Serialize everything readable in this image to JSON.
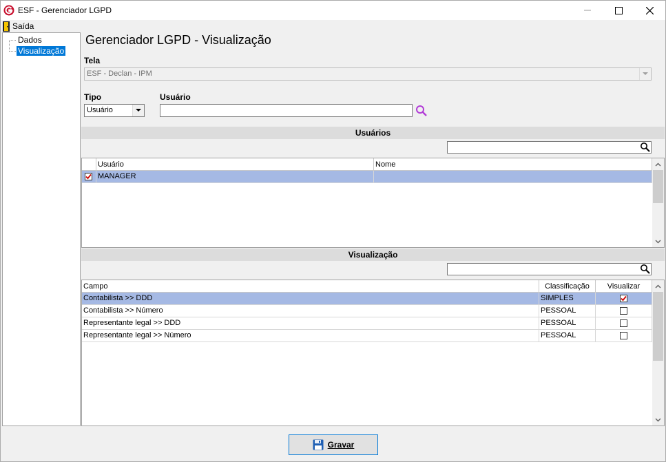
{
  "window": {
    "title": "ESF - Gerenciador LGPD",
    "logo_icon": "app-logo-icon"
  },
  "menu": {
    "exit_label": "Saída"
  },
  "sidebar": {
    "items": [
      {
        "label": "Dados",
        "selected": false
      },
      {
        "label": "Visualização",
        "selected": true
      }
    ]
  },
  "main": {
    "title": "Gerenciador LGPD - Visualização",
    "tela_label": "Tela",
    "tela_value": "ESF - Declan - IPM",
    "tipo_label": "Tipo",
    "tipo_value": "Usuário",
    "usuario_label": "Usuário",
    "usuario_value": ""
  },
  "users_section": {
    "title": "Usuários",
    "search_value": "",
    "columns": [
      "Usuário",
      "Nome"
    ],
    "rows": [
      {
        "usuario": "MANAGER",
        "nome": "",
        "checked": true,
        "selected": true
      }
    ]
  },
  "view_section": {
    "title": "Visualização",
    "search_value": "",
    "columns": [
      "Campo",
      "Classificação",
      "Visualizar"
    ],
    "rows": [
      {
        "campo": "Contabilista >> DDD",
        "classificacao": "SIMPLES",
        "visualizar": true,
        "selected": true
      },
      {
        "campo": "Contabilista >> Número",
        "classificacao": "PESSOAL",
        "visualizar": false,
        "selected": false
      },
      {
        "campo": "Representante legal >> DDD",
        "classificacao": "PESSOAL",
        "visualizar": false,
        "selected": false
      },
      {
        "campo": "Representante legal >> Número",
        "classificacao": "PESSOAL",
        "visualizar": false,
        "selected": false
      }
    ]
  },
  "footer": {
    "save_label": "Gravar"
  },
  "colors": {
    "selection": "#a5b9e4",
    "tree_selection": "#0078d7",
    "check": "#cc0000",
    "accent": "#b13bd6"
  }
}
